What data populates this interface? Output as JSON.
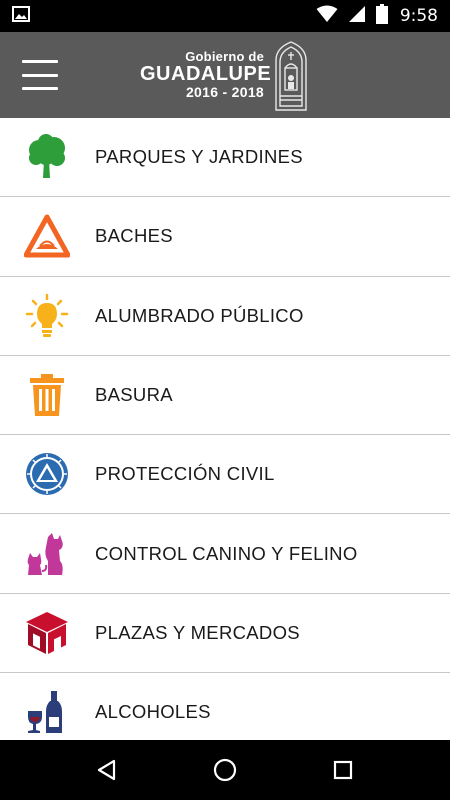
{
  "status_bar": {
    "time": "9:58",
    "icons": [
      "image-icon",
      "wifi-icon",
      "signal-icon",
      "battery-icon"
    ]
  },
  "app_bar": {
    "menu_icon": "hamburger-menu-icon",
    "brand": {
      "line1": "Gobierno de",
      "line2": "GUADALUPE",
      "line3": "2016 - 2018"
    }
  },
  "menu": {
    "items": [
      {
        "label": "PARQUES Y JARDINES",
        "icon": "tree-icon",
        "color": "#2e9e3a"
      },
      {
        "label": "BACHES",
        "icon": "pothole-warning-icon",
        "color": "#f26522"
      },
      {
        "label": "ALUMBRADO PÚBLICO",
        "icon": "lightbulb-icon",
        "color": "#f7b21b"
      },
      {
        "label": "BASURA",
        "icon": "trash-can-icon",
        "color": "#f7941d"
      },
      {
        "label": "PROTECCIÓN CIVIL",
        "icon": "civil-protection-icon",
        "color": "#2b6cb0"
      },
      {
        "label": "CONTROL CANINO Y FELINO",
        "icon": "dog-cat-icon",
        "color": "#c2389a"
      },
      {
        "label": "PLAZAS Y MERCADOS",
        "icon": "market-building-icon",
        "color": "#c8102e"
      },
      {
        "label": "ALCOHOLES",
        "icon": "wine-bottle-icon",
        "color": "#2c3e7a"
      }
    ]
  },
  "nav_bar": {
    "buttons": [
      "back-icon",
      "home-icon",
      "recents-icon"
    ]
  }
}
